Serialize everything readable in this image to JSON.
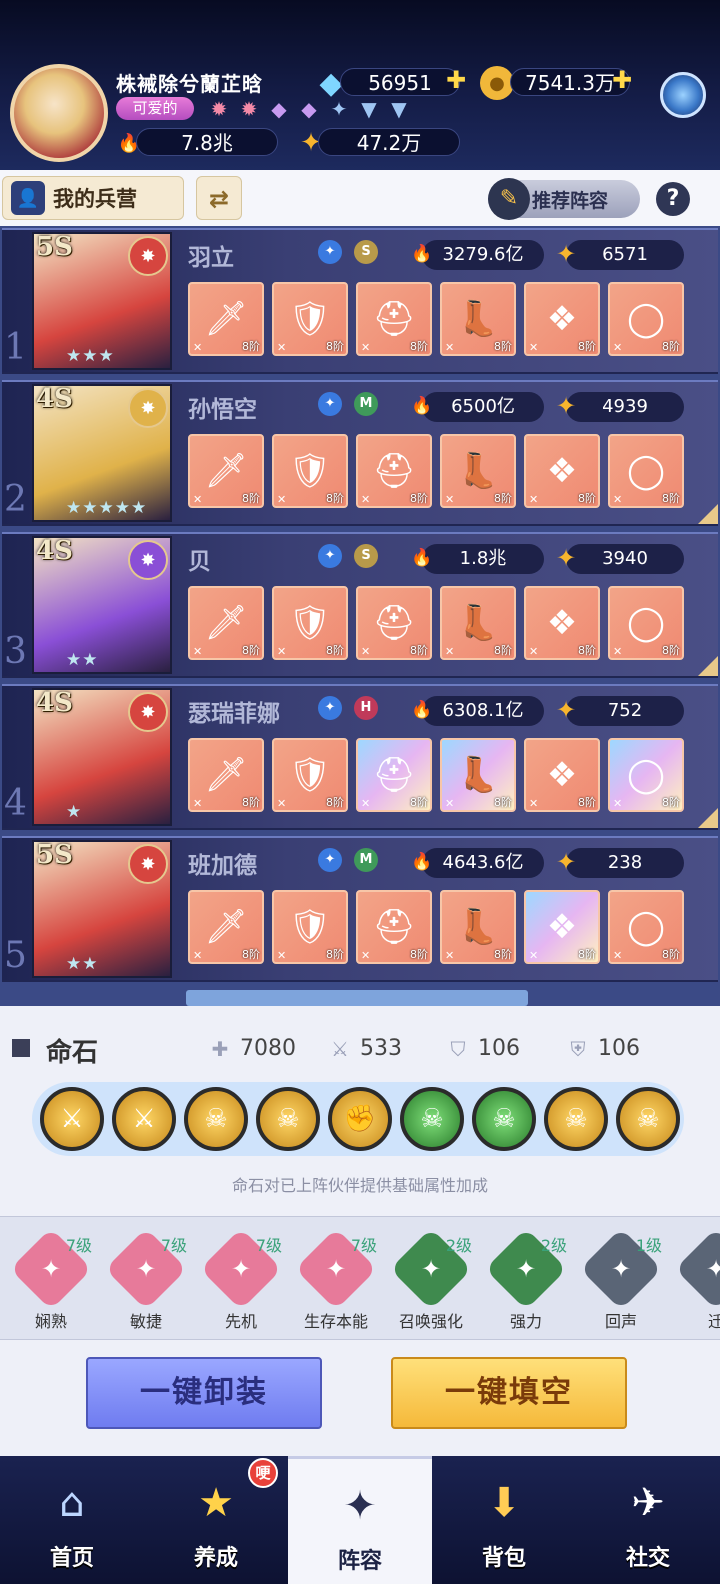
{
  "player": {
    "name": "株裓除兮蘭芷晗",
    "title_tag": "可爱的",
    "combat_power": "7.8兆",
    "star_power": "47.2万"
  },
  "currency": {
    "diamonds": "56951",
    "gold": "7541.3万"
  },
  "toolbar": {
    "barracks_label": "我的兵营",
    "recommend_label": "推荐阵容",
    "help_label": "?"
  },
  "heroes": [
    {
      "index": "1",
      "rank": "5S",
      "name": "羽立",
      "class_badge": "S",
      "power": "3279.6亿",
      "energy": "6571",
      "stars": "★★★",
      "equip_level": "8阶",
      "accent": "#d6453f"
    },
    {
      "index": "2",
      "rank": "4S",
      "name": "孙悟空",
      "class_badge": "M",
      "power": "6500亿",
      "energy": "4939",
      "stars": "★★★★★",
      "equip_level": "8阶",
      "accent": "#e0b24a"
    },
    {
      "index": "3",
      "rank": "4S",
      "name": "贝",
      "class_badge": "S",
      "power": "1.8兆",
      "energy": "3940",
      "stars": "★★",
      "equip_level": "8阶",
      "accent": "#8a4fd6"
    },
    {
      "index": "4",
      "rank": "4S",
      "name": "瑟瑞菲娜",
      "class_badge": "H",
      "power": "6308.1亿",
      "energy": "752",
      "stars": "★",
      "equip_level": "8阶",
      "accent": "#d6453f"
    },
    {
      "index": "5",
      "rank": "5S",
      "name": "班加德",
      "class_badge": "M",
      "power": "4643.6亿",
      "energy": "238",
      "stars": "★★",
      "equip_level": "8阶",
      "accent": "#d6453f"
    }
  ],
  "fate_stone": {
    "title": "命石",
    "stats": {
      "hp": "7080",
      "attack": "533",
      "defense": "106",
      "magic_defense": "106"
    },
    "hint": "命石对已上阵伙伴提供基础属性加成"
  },
  "skills": [
    {
      "name": "娴熟",
      "level": "7级",
      "color": "#e77a9a"
    },
    {
      "name": "敏捷",
      "level": "7级",
      "color": "#e77a9a"
    },
    {
      "name": "先机",
      "level": "7级",
      "color": "#e77a9a"
    },
    {
      "name": "生存本能",
      "level": "7级",
      "color": "#e77a9a"
    },
    {
      "name": "召唤强化",
      "level": "2级",
      "color": "#3f8a4e"
    },
    {
      "name": "强力",
      "level": "2级",
      "color": "#3f8a4e"
    },
    {
      "name": "回声",
      "level": "1级",
      "color": "#5a6576"
    },
    {
      "name": "迁",
      "level": "",
      "color": "#5a6576"
    }
  ],
  "actions": {
    "unequip_all": "一键卸装",
    "fill_empty": "一键填空"
  },
  "nav": {
    "home": "首页",
    "develop": "养成",
    "lineup": "阵容",
    "bag": "背包",
    "social": "社交",
    "badge": "哽"
  },
  "colors": {
    "accent_gold": "#f5b93a",
    "accent_blue": "#6f7cf0",
    "roster_bg": "#3b4a86"
  }
}
